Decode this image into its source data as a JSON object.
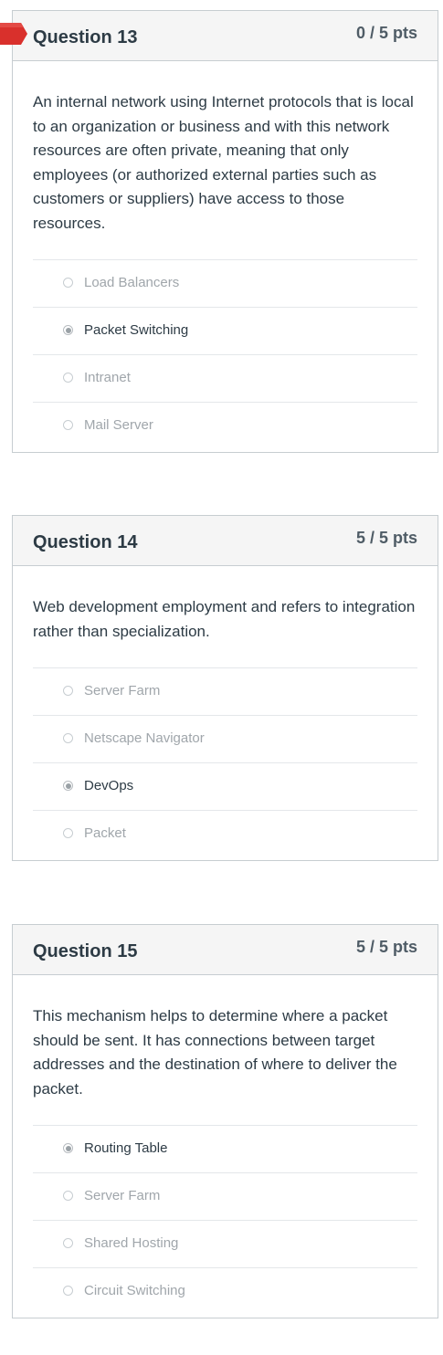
{
  "questions": [
    {
      "title": "Question 13",
      "points": "0 / 5 pts",
      "flagged": true,
      "text": "An internal network using Internet protocols that is local to an organization or business and with this network resources are often private, meaning that only employees (or authorized external parties such as customers or suppliers) have access to those resources.",
      "answers": [
        {
          "label": "Load Balancers",
          "selected": false
        },
        {
          "label": "Packet Switching",
          "selected": true
        },
        {
          "label": "Intranet",
          "selected": false
        },
        {
          "label": "Mail Server",
          "selected": false
        }
      ]
    },
    {
      "title": "Question 14",
      "points": "5 / 5 pts",
      "flagged": false,
      "text": "Web development employment and refers to integration rather than specialization.",
      "answers": [
        {
          "label": "Server Farm",
          "selected": false
        },
        {
          "label": "Netscape Navigator",
          "selected": false
        },
        {
          "label": "DevOps",
          "selected": true
        },
        {
          "label": "Packet",
          "selected": false
        }
      ]
    },
    {
      "title": "Question 15",
      "points": "5 / 5 pts",
      "flagged": false,
      "text": "This mechanism helps to determine where a packet should be sent. It has connections between target addresses and the destination of where to deliver the packet.",
      "answers": [
        {
          "label": "Routing Table",
          "selected": true
        },
        {
          "label": "Server Farm",
          "selected": false
        },
        {
          "label": "Shared Hosting",
          "selected": false
        },
        {
          "label": "Circuit Switching",
          "selected": false
        }
      ]
    }
  ],
  "colors": {
    "flag": "#d9302c",
    "header_bg": "#f5f5f5",
    "border": "#c7cdd1"
  },
  "icons": {
    "flag": "flag-icon",
    "radio": "radio-icon"
  }
}
